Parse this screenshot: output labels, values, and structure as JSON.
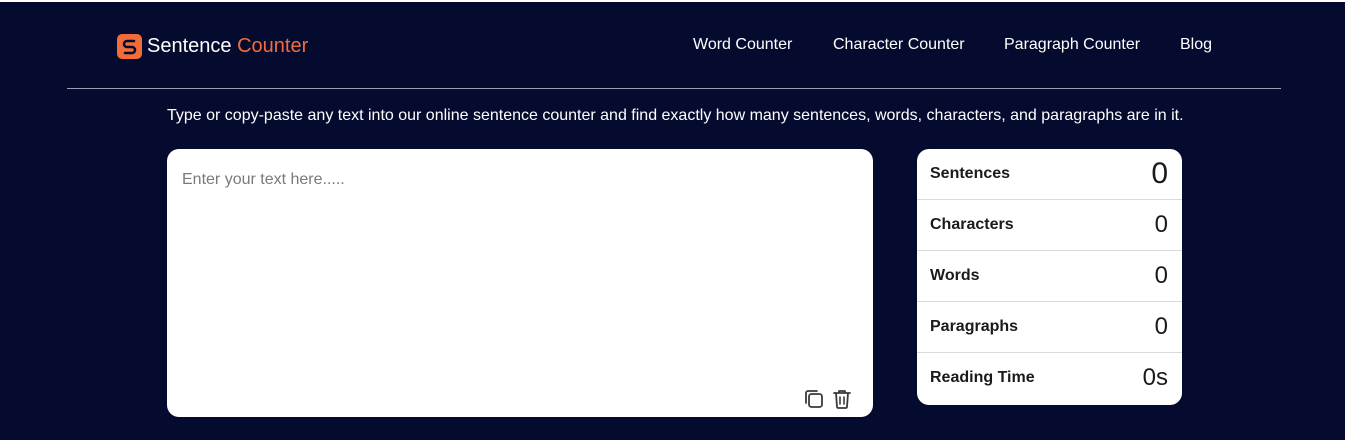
{
  "brand": {
    "name_primary": "Sentence",
    "name_accent": "Counter",
    "icon": "logo-s-icon",
    "accent_color": "#f26b3a"
  },
  "nav": {
    "items": [
      {
        "label": "Word Counter"
      },
      {
        "label": "Character Counter"
      },
      {
        "label": "Paragraph Counter"
      },
      {
        "label": "Blog"
      }
    ]
  },
  "intro": {
    "text": "Type or copy-paste any text into our online sentence counter and find exactly how many sentences, words, characters, and paragraphs are in it."
  },
  "editor": {
    "placeholder": "Enter your text here.....",
    "value": "",
    "actions": [
      {
        "icon": "copy-icon"
      },
      {
        "icon": "trash-icon"
      }
    ]
  },
  "stats": {
    "rows": [
      {
        "label": "Sentences",
        "value": "0"
      },
      {
        "label": "Characters",
        "value": "0"
      },
      {
        "label": "Words",
        "value": "0"
      },
      {
        "label": "Paragraphs",
        "value": "0"
      },
      {
        "label": "Reading Time",
        "value": "0s"
      }
    ]
  },
  "colors": {
    "background": "#050b2e",
    "card": "#ffffff",
    "divider": "#9aa0b8"
  }
}
